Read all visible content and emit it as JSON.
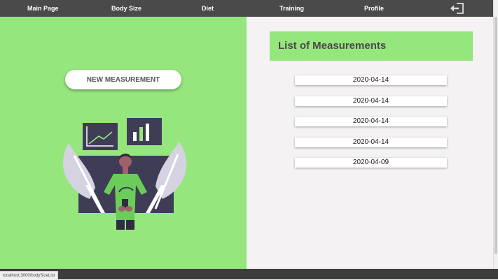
{
  "nav": {
    "items": [
      {
        "label": "Main Page"
      },
      {
        "label": "Body Size"
      },
      {
        "label": "Diet"
      },
      {
        "label": "Training"
      },
      {
        "label": "Profile"
      }
    ],
    "logout_icon": "logout-icon"
  },
  "main": {
    "new_button_label": "NEW MEASUREMENT",
    "illustration": "person-with-charts-illustration"
  },
  "list": {
    "title": "List of Measurements",
    "items": [
      "2020-04-14",
      "2020-04-14",
      "2020-04-14",
      "2020-04-14",
      "2020-04-09"
    ]
  },
  "status": {
    "url": "localhost:3000/bodySizeList"
  },
  "colors": {
    "accent_green": "#96e67e",
    "nav_bg": "#4a4a4a",
    "panel_bg": "#f4f2f2"
  }
}
